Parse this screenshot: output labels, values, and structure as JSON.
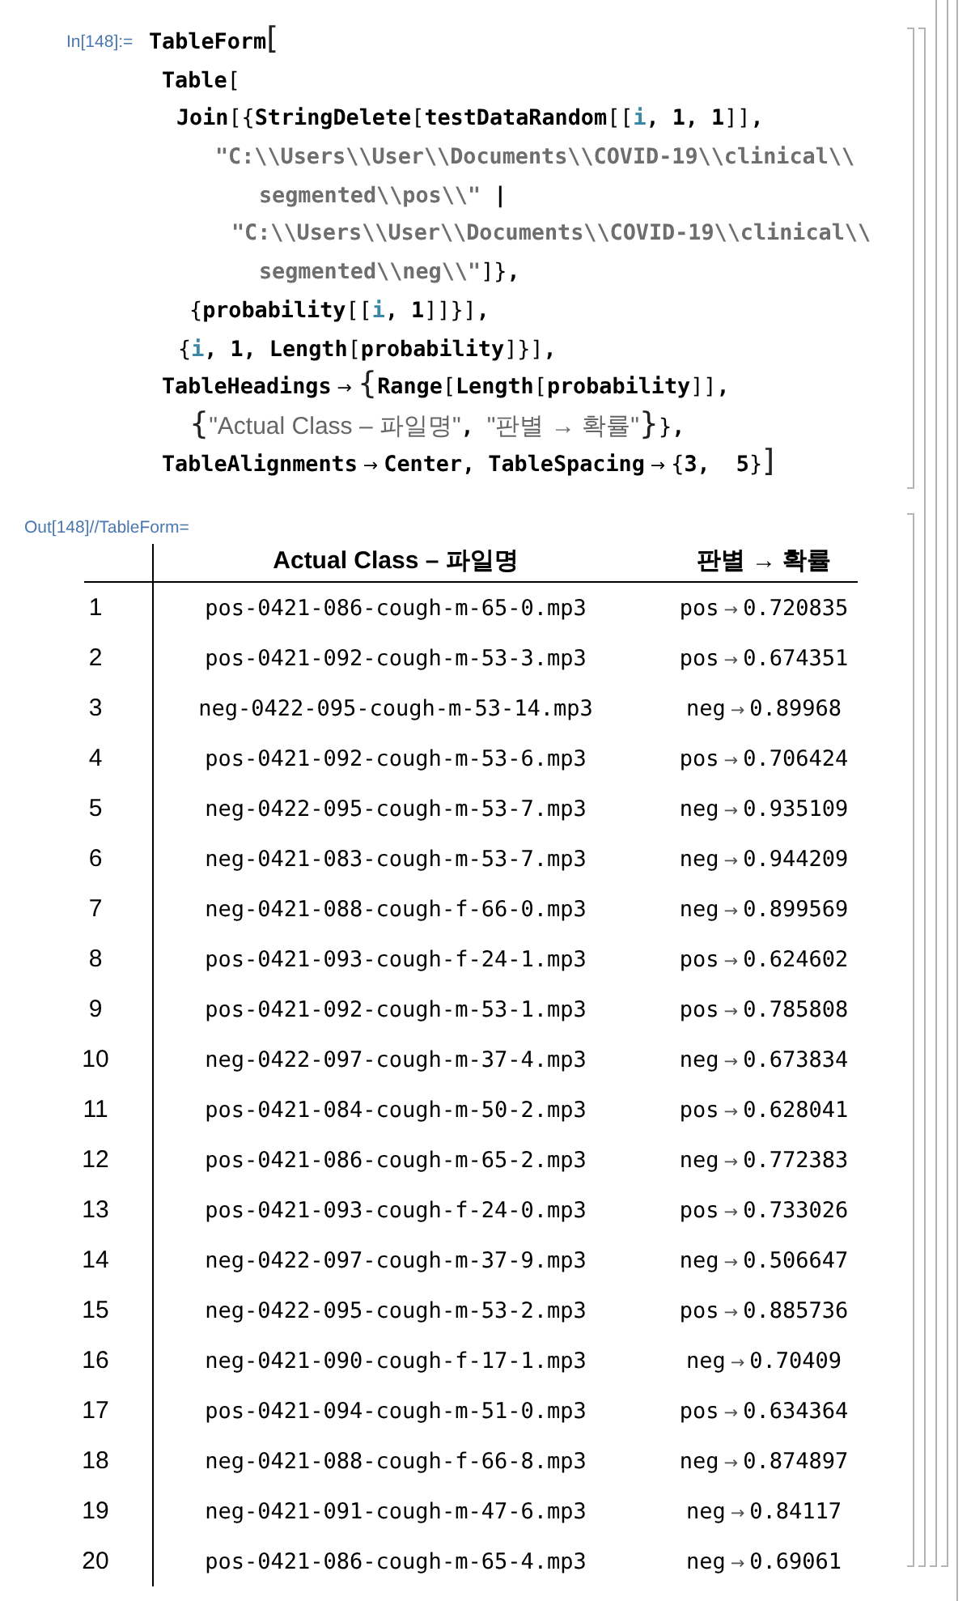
{
  "input_cell": {
    "label": "In[148]:=",
    "lines": [
      [
        {
          "text": "TableForm",
          "kind": "sym"
        },
        {
          "text": "[",
          "kind": "big"
        }
      ],
      [
        {
          "text": "Table",
          "kind": "sym"
        },
        {
          "text": "[",
          "kind": "punct"
        }
      ],
      [
        {
          "text": "Join",
          "kind": "sym"
        },
        {
          "text": "[{",
          "kind": "punct"
        },
        {
          "text": "StringDelete",
          "kind": "sym"
        },
        {
          "text": "[",
          "kind": "punct"
        },
        {
          "text": "testDataRandom",
          "kind": "sym"
        },
        {
          "text": "[[",
          "kind": "punct"
        },
        {
          "text": "i",
          "kind": "var"
        },
        {
          "text": ", 1, 1",
          "kind": "sym"
        },
        {
          "text": "]]",
          "kind": "punct"
        },
        {
          "text": ",",
          "kind": "sym"
        }
      ],
      [
        {
          "text": "\"C:\\\\Users\\\\User\\\\Documents\\\\COVID-19\\\\clinical\\\\",
          "kind": "str"
        }
      ],
      [
        {
          "text": "segmented\\\\pos\\\\\"",
          "kind": "str"
        },
        {
          "text": " |",
          "kind": "sym"
        }
      ],
      [
        {
          "text": "\"C:\\\\Users\\\\User\\\\Documents\\\\COVID-19\\\\clinical\\\\",
          "kind": "str"
        }
      ],
      [
        {
          "text": "segmented\\\\neg\\\\\"",
          "kind": "str"
        },
        {
          "text": "]}",
          "kind": "punct"
        },
        {
          "text": ",",
          "kind": "sym"
        }
      ],
      [
        {
          "text": "{",
          "kind": "punct"
        },
        {
          "text": "probability",
          "kind": "sym"
        },
        {
          "text": "[[",
          "kind": "punct"
        },
        {
          "text": "i",
          "kind": "var"
        },
        {
          "text": ", 1",
          "kind": "sym"
        },
        {
          "text": "]]}]",
          "kind": "punct"
        },
        {
          "text": ",",
          "kind": "sym"
        }
      ],
      [
        {
          "text": "{",
          "kind": "punct"
        },
        {
          "text": "i",
          "kind": "var"
        },
        {
          "text": ", 1, Length",
          "kind": "sym"
        },
        {
          "text": "[",
          "kind": "punct"
        },
        {
          "text": "probability",
          "kind": "sym"
        },
        {
          "text": "]}]",
          "kind": "punct"
        },
        {
          "text": ",",
          "kind": "sym"
        }
      ],
      [
        {
          "text": "TableHeadings",
          "kind": "sym"
        },
        {
          "text": " → ",
          "kind": "op"
        },
        {
          "text": "{",
          "kind": "big"
        },
        {
          "text": "Range",
          "kind": "sym"
        },
        {
          "text": "[",
          "kind": "punct"
        },
        {
          "text": "Length",
          "kind": "sym"
        },
        {
          "text": "[",
          "kind": "punct"
        },
        {
          "text": "probability",
          "kind": "sym"
        },
        {
          "text": "]]",
          "kind": "punct"
        },
        {
          "text": ",",
          "kind": "sym"
        }
      ],
      [
        {
          "text": "{",
          "kind": "big"
        },
        {
          "text": "\"Actual Class – 파일명\"",
          "kind": "text"
        },
        {
          "text": ", ",
          "kind": "sym"
        },
        {
          "text": "\"판별 → 확률\"",
          "kind": "text"
        },
        {
          "text": "}",
          "kind": "big"
        },
        {
          "text": "}",
          "kind": "punct"
        },
        {
          "text": ",",
          "kind": "sym"
        }
      ],
      [
        {
          "text": "TableAlignments",
          "kind": "sym"
        },
        {
          "text": " → ",
          "kind": "op"
        },
        {
          "text": "Center, TableSpacing",
          "kind": "sym"
        },
        {
          "text": " → ",
          "kind": "op"
        },
        {
          "text": "{",
          "kind": "punct"
        },
        {
          "text": "3,  5",
          "kind": "sym"
        },
        {
          "text": "}",
          "kind": "punct"
        },
        {
          "text": "]",
          "kind": "big"
        }
      ]
    ]
  },
  "output_cell": {
    "label": "Out[148]//TableForm=",
    "table": {
      "columns": [
        "Actual Class – 파일명",
        "판별 → 확률"
      ],
      "rows": [
        {
          "header": "1",
          "file": "pos-0421-086-cough-m-65-0.mp3",
          "predicted": "pos",
          "arrow": "→",
          "probability": "0.720835"
        },
        {
          "header": "2",
          "file": "pos-0421-092-cough-m-53-3.mp3",
          "predicted": "pos",
          "arrow": "→",
          "probability": "0.674351"
        },
        {
          "header": "3",
          "file": "neg-0422-095-cough-m-53-14.mp3",
          "predicted": "neg",
          "arrow": "→",
          "probability": "0.89968"
        },
        {
          "header": "4",
          "file": "pos-0421-092-cough-m-53-6.mp3",
          "predicted": "pos",
          "arrow": "→",
          "probability": "0.706424"
        },
        {
          "header": "5",
          "file": "neg-0422-095-cough-m-53-7.mp3",
          "predicted": "neg",
          "arrow": "→",
          "probability": "0.935109"
        },
        {
          "header": "6",
          "file": "neg-0421-083-cough-m-53-7.mp3",
          "predicted": "neg",
          "arrow": "→",
          "probability": "0.944209"
        },
        {
          "header": "7",
          "file": "neg-0421-088-cough-f-66-0.mp3",
          "predicted": "neg",
          "arrow": "→",
          "probability": "0.899569"
        },
        {
          "header": "8",
          "file": "pos-0421-093-cough-f-24-1.mp3",
          "predicted": "pos",
          "arrow": "→",
          "probability": "0.624602"
        },
        {
          "header": "9",
          "file": "pos-0421-092-cough-m-53-1.mp3",
          "predicted": "pos",
          "arrow": "→",
          "probability": "0.785808"
        },
        {
          "header": "10",
          "file": "neg-0422-097-cough-m-37-4.mp3",
          "predicted": "neg",
          "arrow": "→",
          "probability": "0.673834"
        },
        {
          "header": "11",
          "file": "pos-0421-084-cough-m-50-2.mp3",
          "predicted": "pos",
          "arrow": "→",
          "probability": "0.628041"
        },
        {
          "header": "12",
          "file": "pos-0421-086-cough-m-65-2.mp3",
          "predicted": "neg",
          "arrow": "→",
          "probability": "0.772383"
        },
        {
          "header": "13",
          "file": "pos-0421-093-cough-f-24-0.mp3",
          "predicted": "pos",
          "arrow": "→",
          "probability": "0.733026"
        },
        {
          "header": "14",
          "file": "neg-0422-097-cough-m-37-9.mp3",
          "predicted": "neg",
          "arrow": "→",
          "probability": "0.506647"
        },
        {
          "header": "15",
          "file": "neg-0422-095-cough-m-53-2.mp3",
          "predicted": "pos",
          "arrow": "→",
          "probability": "0.885736"
        },
        {
          "header": "16",
          "file": "neg-0421-090-cough-f-17-1.mp3",
          "predicted": "neg",
          "arrow": "→",
          "probability": "0.70409"
        },
        {
          "header": "17",
          "file": "pos-0421-094-cough-m-51-0.mp3",
          "predicted": "pos",
          "arrow": "→",
          "probability": "0.634364"
        },
        {
          "header": "18",
          "file": "neg-0421-088-cough-f-66-8.mp3",
          "predicted": "neg",
          "arrow": "→",
          "probability": "0.874897"
        },
        {
          "header": "19",
          "file": "neg-0421-091-cough-m-47-6.mp3",
          "predicted": "neg",
          "arrow": "→",
          "probability": "0.84117"
        },
        {
          "header": "20",
          "file": "pos-0421-086-cough-m-65-4.mp3",
          "predicted": "neg",
          "arrow": "→",
          "probability": "0.69061"
        }
      ]
    }
  }
}
